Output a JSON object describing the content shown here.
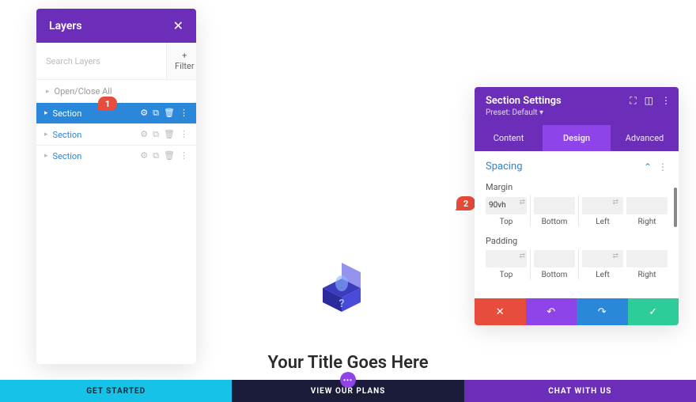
{
  "layers": {
    "title": "Layers",
    "search_placeholder": "Search Layers",
    "filter_label": "+ Filter",
    "toggle_all": "Open/Close All",
    "items": [
      {
        "label": "Section",
        "active": true
      },
      {
        "label": "Section",
        "active": false
      },
      {
        "label": "Section",
        "active": false
      }
    ]
  },
  "callouts": {
    "one": "1",
    "two": "2"
  },
  "settings": {
    "title": "Section Settings",
    "preset": "Preset: Default ▾",
    "tabs": {
      "content": "Content",
      "design": "Design",
      "advanced": "Advanced"
    },
    "spacing": {
      "title": "Spacing",
      "margin_label": "Margin",
      "padding_label": "Padding",
      "top": "Top",
      "bottom": "Bottom",
      "left": "Left",
      "right": "Right",
      "margin_top_value": "90vh"
    }
  },
  "center": {
    "title": "Your Title Goes Here"
  },
  "bottom": {
    "get_started": "GET STARTED",
    "view_plans": "VIEW OUR PLANS",
    "chat": "CHAT WITH US",
    "bubble": "⋯"
  }
}
